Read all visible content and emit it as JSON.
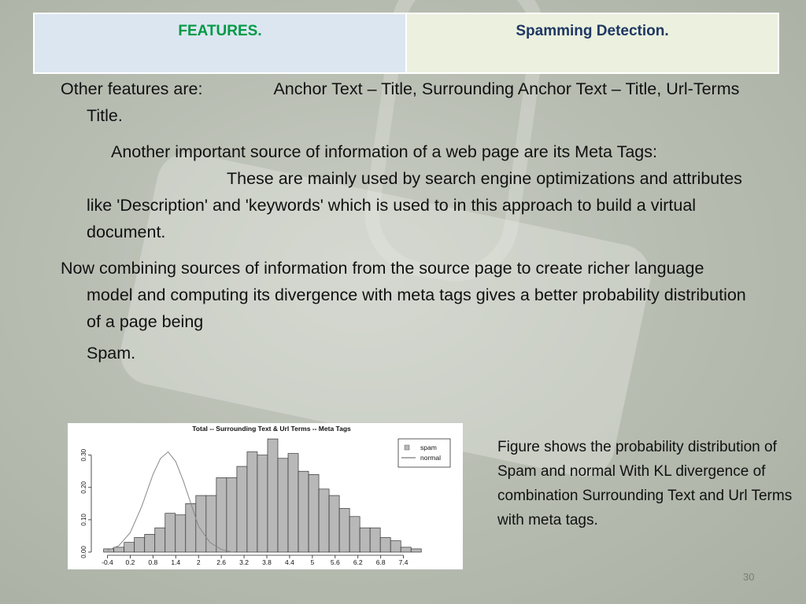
{
  "header": {
    "features_label": "FEATURES.",
    "topic_label": "Spamming Detection."
  },
  "body": {
    "p1_lead": "Other features are:",
    "p1_rest": "Anchor Text – Title, Surrounding Anchor Text – Title, Url-Terms Title.",
    "p2_a": "Another important source of information of a web page are its Meta Tags:",
    "p2_b": "These are mainly used by search engine optimizations and attributes like 'Description' and 'keywords' which is used to in this approach to build a virtual document.",
    "p3": "Now combining sources of information from the source page to create richer language model and computing its divergence with meta tags gives a better probability distribution  of a page being",
    "p3_end": "Spam."
  },
  "caption": {
    "text": "Figure shows the probability distribution of Spam and normal With KL divergence of combination Surrounding Text and Url Terms with meta tags."
  },
  "page_number": "30",
  "chart_data": {
    "type": "bar",
    "title": "Total -- Surrounding Text & Url Terms -- Meta Tags",
    "xlabel": "",
    "ylabel": "",
    "xlim": [
      -0.7,
      8.3
    ],
    "ylim": [
      0,
      0.36
    ],
    "x_ticks": [
      "-0.4",
      "0.2",
      "0.8",
      "1.4",
      "2",
      "2.6",
      "3.2",
      "3.8",
      "4.4",
      "5",
      "5.6",
      "6.2",
      "6.8",
      "7.4"
    ],
    "x_tick_values": [
      -0.4,
      0.2,
      0.8,
      1.4,
      2,
      2.6,
      3.2,
      3.8,
      4.4,
      5,
      5.6,
      6.2,
      6.8,
      7.4
    ],
    "y_ticks": [
      "0.00",
      "0.10",
      "0.20",
      "0.30"
    ],
    "y_tick_values": [
      0,
      0.1,
      0.2,
      0.3
    ],
    "grid": false,
    "legend_position": "top-right",
    "bin_width": 0.3,
    "series": [
      {
        "name": "spam",
        "kind": "histogram",
        "color": "#b8b8b8",
        "bin_starts": [
          -0.4,
          -0.1,
          0.2,
          0.5,
          0.8,
          1.1,
          1.4,
          1.7,
          2.0,
          2.3,
          2.6,
          2.9,
          3.2,
          3.5,
          3.8,
          4.1,
          4.4,
          4.7,
          5.0,
          5.3,
          5.6,
          5.9,
          6.2,
          6.5,
          6.8,
          7.1,
          7.4,
          7.7,
          8.0
        ],
        "values": [
          0.01,
          0.015,
          0.03,
          0.045,
          0.055,
          0.075,
          0.12,
          0.115,
          0.15,
          0.175,
          0.175,
          0.23,
          0.23,
          0.265,
          0.31,
          0.3,
          0.35,
          0.29,
          0.305,
          0.25,
          0.24,
          0.195,
          0.175,
          0.135,
          0.11,
          0.075,
          0.075,
          0.045,
          0.035,
          0.015,
          0.01
        ]
      },
      {
        "name": "normal",
        "kind": "line",
        "color": "#888888",
        "x": [
          -0.4,
          -0.1,
          0.2,
          0.5,
          0.8,
          1.0,
          1.2,
          1.4,
          1.6,
          1.8,
          2.0,
          2.3,
          2.6,
          2.9
        ],
        "values": [
          0.005,
          0.02,
          0.06,
          0.14,
          0.24,
          0.29,
          0.31,
          0.28,
          0.22,
          0.15,
          0.08,
          0.03,
          0.008,
          0.0
        ]
      }
    ]
  }
}
